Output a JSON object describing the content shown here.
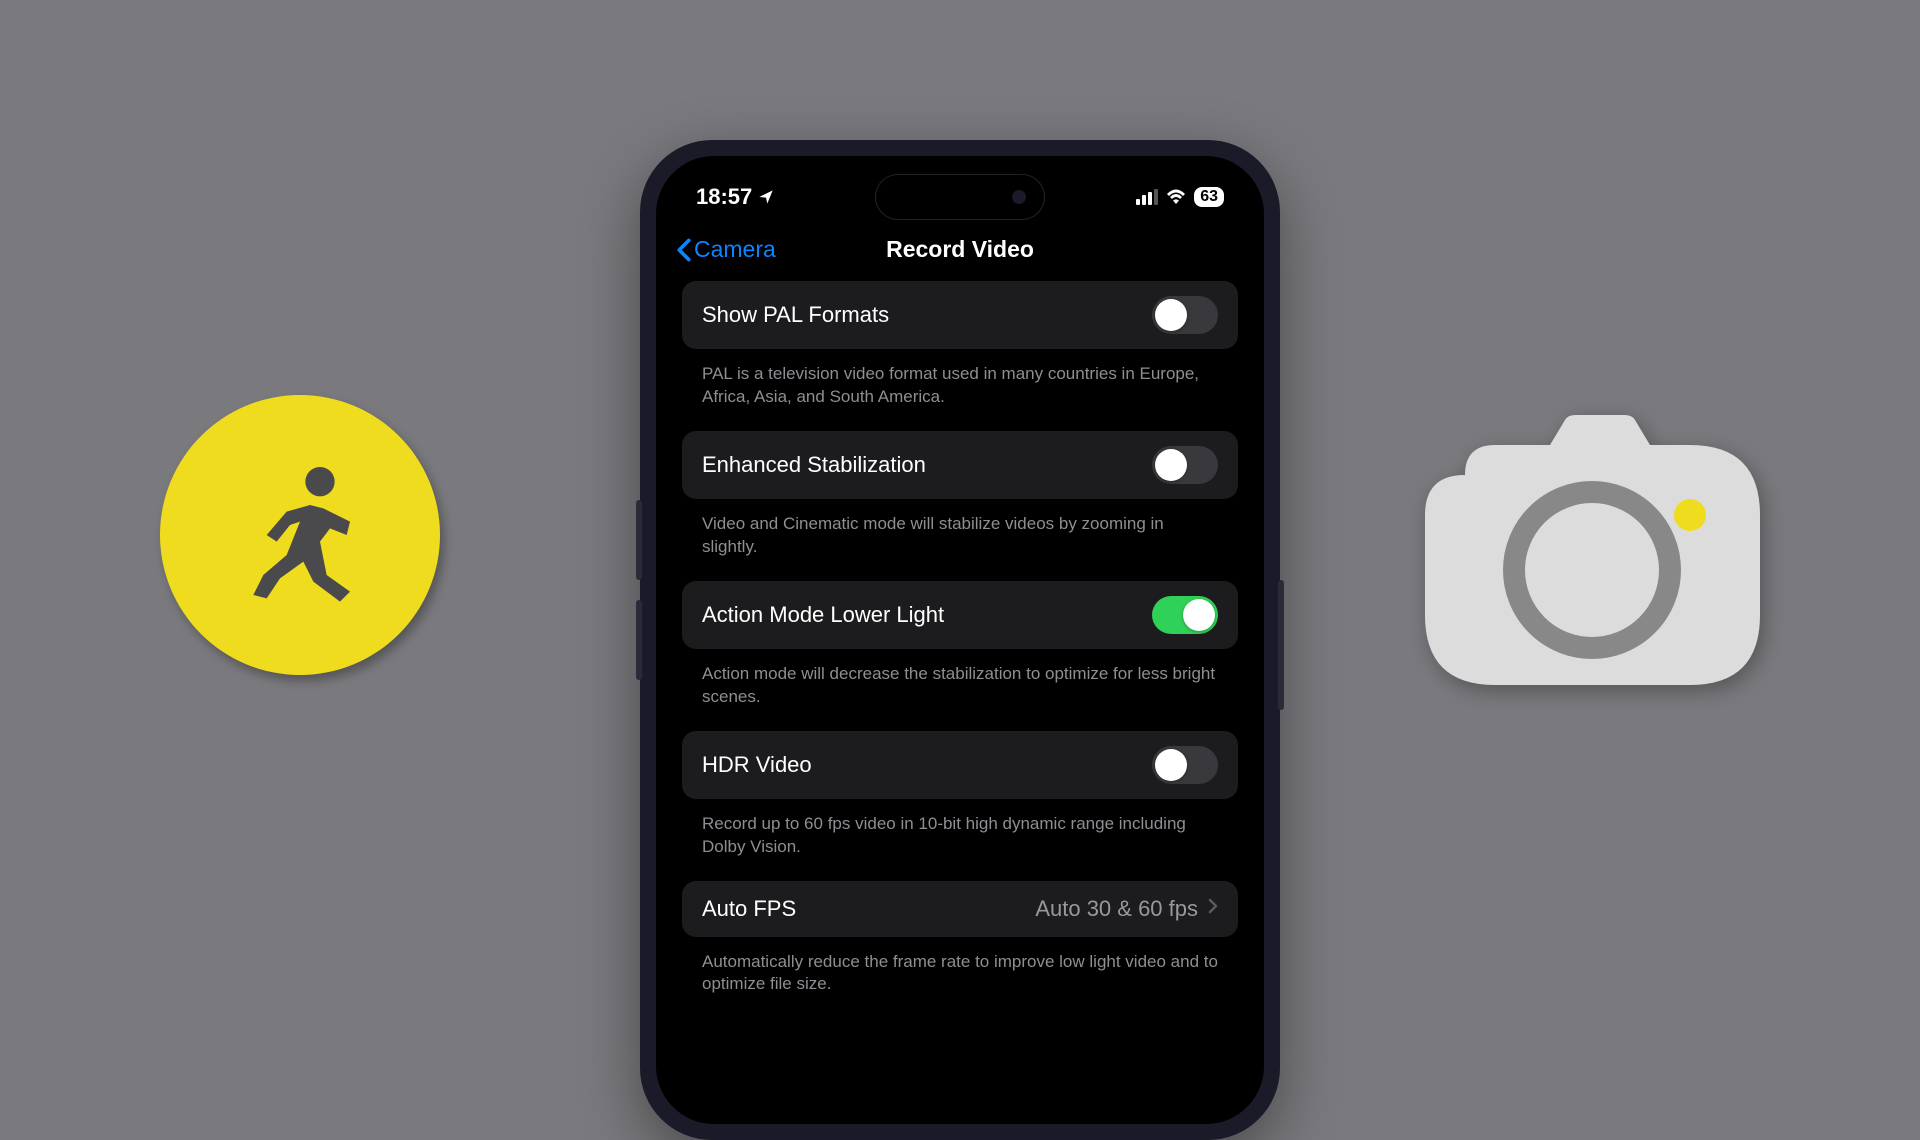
{
  "status": {
    "time": "18:57",
    "battery": "63"
  },
  "nav": {
    "back": "Camera",
    "title": "Record Video"
  },
  "settings": [
    {
      "label": "Show PAL Formats",
      "toggle": "off",
      "description": "PAL is a television video format used in many countries in Europe, Africa, Asia, and South America."
    },
    {
      "label": "Enhanced Stabilization",
      "toggle": "off",
      "description": "Video and Cinematic mode will stabilize videos by zooming in slightly."
    },
    {
      "label": "Action Mode Lower Light",
      "toggle": "on",
      "description": "Action mode will decrease the stabilization to optimize for less bright scenes."
    },
    {
      "label": "HDR Video",
      "toggle": "off",
      "description": "Record up to 60 fps video in 10-bit high dynamic range including Dolby Vision."
    },
    {
      "label": "Auto FPS",
      "value": "Auto 30 & 60 fps",
      "description": "Automatically reduce the frame rate to improve low light video and to optimize file size."
    }
  ]
}
